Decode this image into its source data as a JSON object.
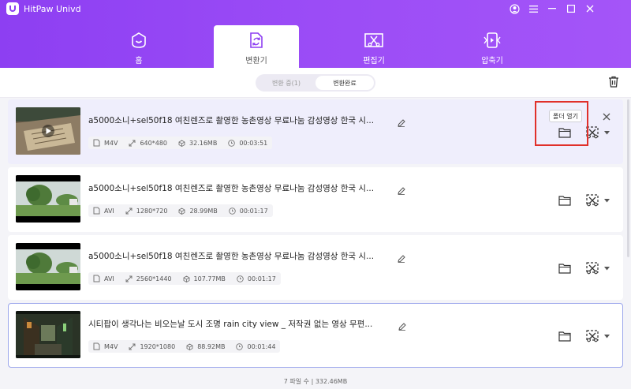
{
  "app": {
    "title": "HitPaw Univd"
  },
  "tabs": [
    {
      "label": "홈"
    },
    {
      "label": "변환기"
    },
    {
      "label": "편집기"
    },
    {
      "label": "압축기"
    }
  ],
  "subtabs": {
    "converting": "변환 중(1)",
    "converted": "변환완료"
  },
  "tooltip": "폴더 열기",
  "items": [
    {
      "title": "a5000소니+sel50f18 여친렌즈로 촬영한 농촌영상 무료나눔 감성영상 한국 시...",
      "format": "M4V",
      "resolution": "640*480",
      "size": "32.16MB",
      "duration": "00:03:51"
    },
    {
      "title": "a5000소니+sel50f18 여친렌즈로 촬영한 농촌영상 무료나눔 감성영상 한국 시...",
      "format": "AVI",
      "resolution": "1280*720",
      "size": "28.99MB",
      "duration": "00:01:17"
    },
    {
      "title": "a5000소니+sel50f18 여친렌즈로 촬영한 농촌영상 무료나눔 감성영상 한국 시...",
      "format": "AVI",
      "resolution": "2560*1440",
      "size": "107.77MB",
      "duration": "00:01:17"
    },
    {
      "title": "시티팝이 생각나는 비오는날 도시 조명 rain city view _ 저작권 없는 영상 무편...",
      "format": "M4V",
      "resolution": "1920*1080",
      "size": "88.92MB",
      "duration": "00:01:44"
    }
  ],
  "footer": "7 파일 수 | 332.46MB",
  "colors": {
    "accent": "#8d3ff2",
    "highlight": "#e0302a"
  }
}
